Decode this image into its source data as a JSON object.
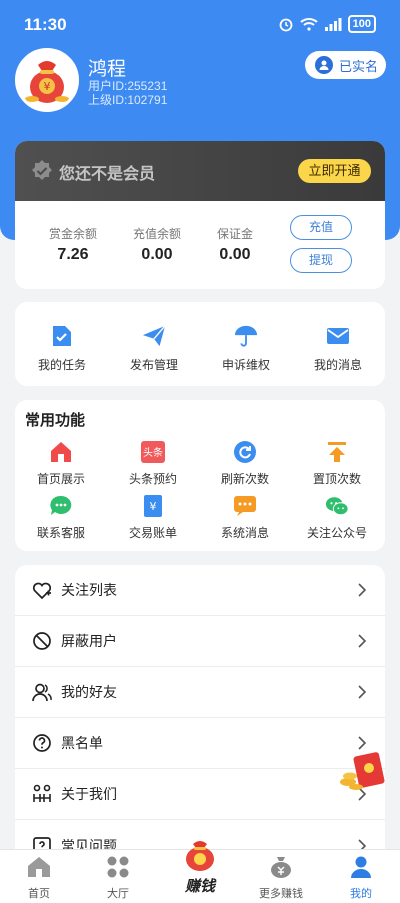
{
  "status_bar": {
    "time": "11:30",
    "battery": "100"
  },
  "profile": {
    "name": "鸿程",
    "user_id": "用户ID:255231",
    "parent_id": "上级ID:102791",
    "verified_label": "已实名"
  },
  "member": {
    "text": "您还不是会员",
    "open_label": "立即开通"
  },
  "balances": [
    {
      "label": "赏金余额",
      "value": "7.26"
    },
    {
      "label": "充值余额",
      "value": "0.00"
    },
    {
      "label": "保证金",
      "value": "0.00"
    }
  ],
  "actions": {
    "recharge": "充值",
    "withdraw": "提现"
  },
  "quick_links": [
    {
      "label": "我的任务",
      "icon": "task-check-icon"
    },
    {
      "label": "发布管理",
      "icon": "paper-plane-icon"
    },
    {
      "label": "申诉维权",
      "icon": "umbrella-icon"
    },
    {
      "label": "我的消息",
      "icon": "mail-icon"
    }
  ],
  "functions": {
    "title": "常用功能",
    "items": [
      {
        "label": "首页展示",
        "icon": "home-icon"
      },
      {
        "label": "头条预约",
        "icon": "toutiao-icon",
        "icon_text": "头条"
      },
      {
        "label": "刷新次数",
        "icon": "refresh-icon"
      },
      {
        "label": "置顶次数",
        "icon": "pin-top-icon"
      },
      {
        "label": "联系客服",
        "icon": "chat-bubble-icon"
      },
      {
        "label": "交易账单",
        "icon": "bill-icon"
      },
      {
        "label": "系统消息",
        "icon": "system-message-icon"
      },
      {
        "label": "关注公众号",
        "icon": "wechat-icon"
      }
    ]
  },
  "menu": [
    {
      "label": "关注列表",
      "icon": "heart-plus-icon"
    },
    {
      "label": "屏蔽用户",
      "icon": "block-icon"
    },
    {
      "label": "我的好友",
      "icon": "friends-icon"
    },
    {
      "label": "黑名单",
      "icon": "question-icon"
    },
    {
      "label": "关于我们",
      "icon": "about-icon"
    },
    {
      "label": "常见问题",
      "icon": "faq-icon"
    }
  ],
  "nav": {
    "home": "首页",
    "hall": "大厅",
    "earn": "赚钱",
    "more": "更多赚钱",
    "mine": "我的"
  },
  "colors": {
    "brand": "#3d8bf2",
    "gold": "#fbd54a",
    "active": "#2d7de5"
  }
}
